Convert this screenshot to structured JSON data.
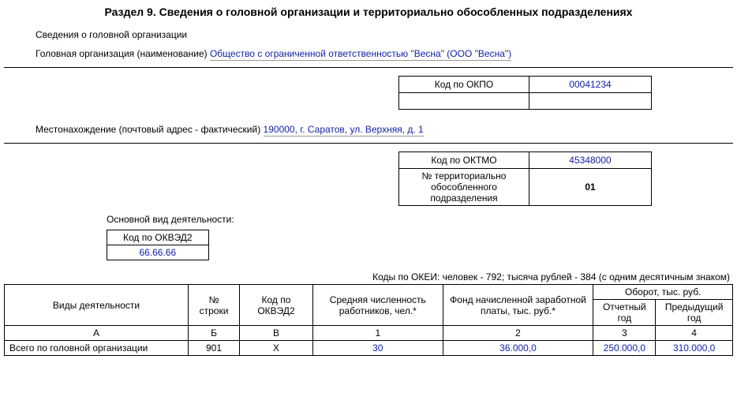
{
  "title": "Раздел 9. Сведения о головной организации и территориально обособленных подразделениях",
  "subheader": "Сведения о головной организации",
  "org_label": "Головная организация (наименование) ",
  "org_value": "Общество с ограниченной ответственностью \"Весна\" (ООО \"Весна\")",
  "okpo": {
    "label": "Код по ОКПО",
    "value": "00041234"
  },
  "addr_label": "Местонахождение (почтовый адрес - фактический) ",
  "addr_value": "190000, г. Саратов, ул. Верхняя, д. 1",
  "oktmo": {
    "label": "Код по ОКТМО",
    "value": "45348000"
  },
  "terr": {
    "label": "№ территориально обособленного подразделения",
    "value": "01"
  },
  "activity_label": "Основной вид деятельности:",
  "okved": {
    "label": "Код по ОКВЭД2",
    "value": "66.66.66"
  },
  "okei": "Коды по ОКЕИ: человек - 792; тысяча рублей - 384 (с одним десятичным знаком)",
  "table": {
    "head": {
      "activity": "Виды деятельности",
      "row_no": "№ строки",
      "okved": "Код по ОКВЭД2",
      "avg": "Средняя численность работников, чел.*",
      "fund": "Фонд начисленной заработной платы, тыс. руб.*",
      "turnover": "Оборот, тыс. руб.",
      "report_year": "Отчетный год",
      "prev_year": "Предыдущий год"
    },
    "letters": {
      "a": "А",
      "b": "Б",
      "v": "В",
      "c1": "1",
      "c2": "2",
      "c3": "3",
      "c4": "4"
    },
    "row": {
      "label": "Всего по головной организации",
      "no": "901",
      "okved": "Х",
      "avg": "30",
      "fund": "36.000,0",
      "turn_cur": "250.000,0",
      "turn_prev": "310.000,0"
    }
  }
}
